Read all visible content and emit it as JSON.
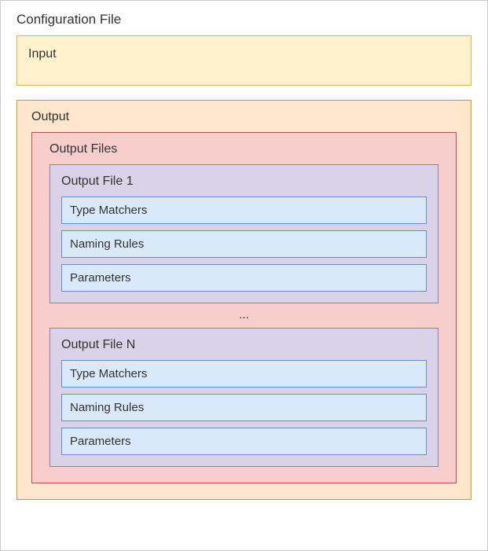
{
  "title": "Configuration File",
  "input": {
    "label": "Input"
  },
  "output": {
    "label": "Output",
    "files_label": "Output Files",
    "ellipsis": "...",
    "items": [
      {
        "label": "Output File 1",
        "rows": [
          "Type Matchers",
          "Naming Rules",
          "Parameters"
        ]
      },
      {
        "label": "Output File N",
        "rows": [
          "Type Matchers",
          "Naming Rules",
          "Parameters"
        ]
      }
    ]
  }
}
